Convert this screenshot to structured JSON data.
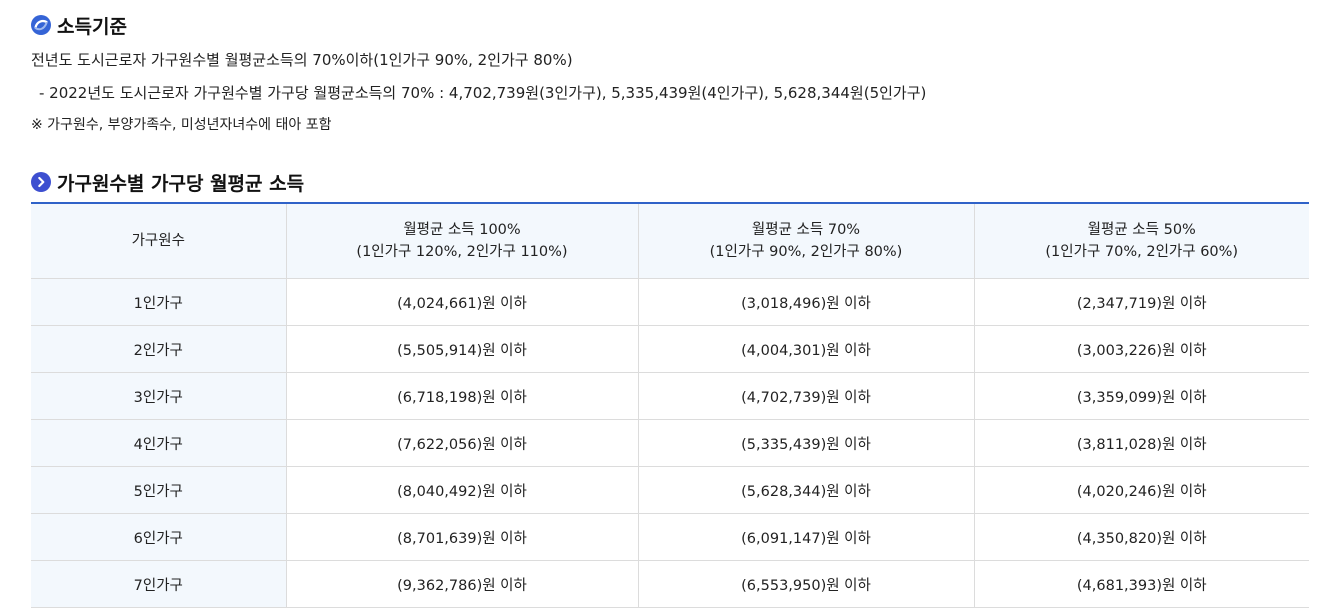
{
  "section1": {
    "title": "소득기준",
    "line1": "전년도 도시근로자 가구원수별 월평균소득의 70%이하(1인가구 90%, 2인가구 80%)",
    "line2": "- 2022년도 도시근로자 가구원수별 가구당 월평균소득의 70% : 4,702,739원(3인가구), 5,335,439원(4인가구), 5,628,344원(5인가구)",
    "note": "※ 가구원수, 부양가족수, 미성년자녀수에 태아 포함"
  },
  "section2": {
    "title": "가구원수별 가구당 월평균 소득"
  },
  "table": {
    "headers": [
      {
        "line1": "가구원수",
        "line2": ""
      },
      {
        "line1": "월평균 소득 100%",
        "line2": "(1인가구 120%, 2인가구 110%)"
      },
      {
        "line1": "월평균 소득 70%",
        "line2": "(1인가구 90%, 2인가구 80%)"
      },
      {
        "line1": "월평균 소득 50%",
        "line2": "(1인가구 70%, 2인가구 60%)"
      }
    ],
    "rows": [
      [
        "1인가구",
        "(4,024,661)원 이하",
        "(3,018,496)원 이하",
        "(2,347,719)원 이하"
      ],
      [
        "2인가구",
        "(5,505,914)원 이하",
        "(4,004,301)원 이하",
        "(3,003,226)원 이하"
      ],
      [
        "3인가구",
        "(6,718,198)원 이하",
        "(4,702,739)원 이하",
        "(3,359,099)원 이하"
      ],
      [
        "4인가구",
        "(7,622,056)원 이하",
        "(5,335,439)원 이하",
        "(3,811,028)원 이하"
      ],
      [
        "5인가구",
        "(8,040,492)원 이하",
        "(5,628,344)원 이하",
        "(4,020,246)원 이하"
      ],
      [
        "6인가구",
        "(8,701,639)원 이하",
        "(6,091,147)원 이하",
        "(4,350,820)원 이하"
      ],
      [
        "7인가구",
        "(9,362,786)원 이하",
        "(6,553,950)원 이하",
        "(4,681,393)원 이하"
      ]
    ]
  },
  "icons": {
    "section1_icon": "swirl-icon",
    "section2_icon": "chevron-right-circle-icon"
  },
  "colors": {
    "accent": "#2f62c8",
    "icon_blue": "#3564d6",
    "header_bg": "#f3f8fd",
    "border": "#dcdcdc"
  }
}
